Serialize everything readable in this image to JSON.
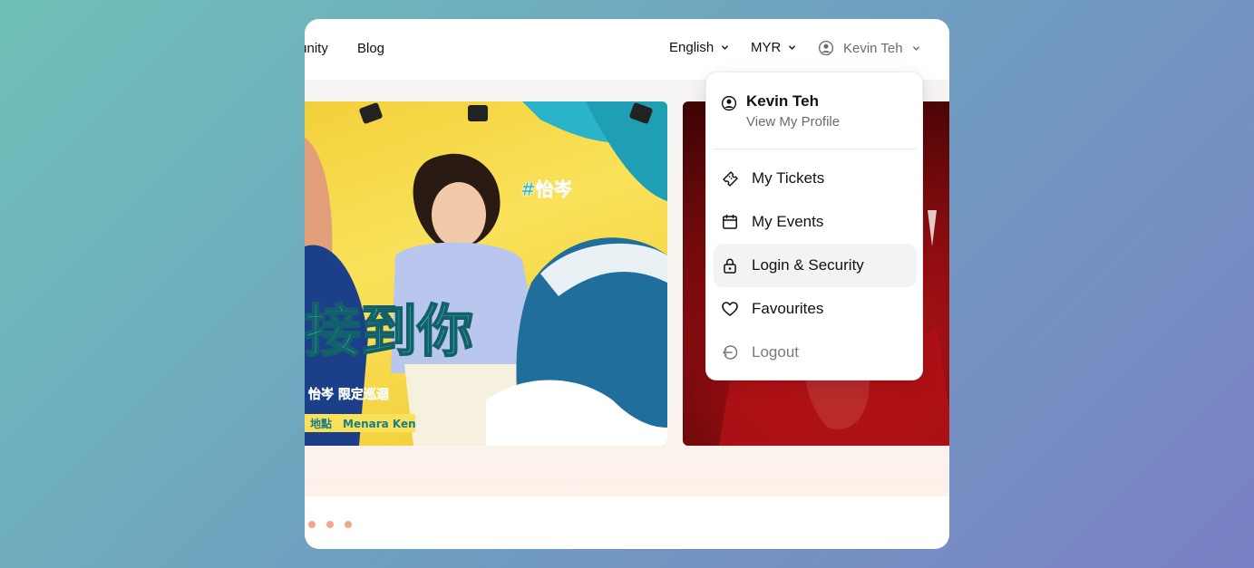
{
  "nav": {
    "community_label": "Community",
    "blog_label": "Blog",
    "language": "English",
    "currency": "MYR",
    "user_name": "Kevin Teh"
  },
  "banner1": {
    "hashtag": "#怡岑",
    "title": "接到你",
    "subtitle": "怡岑 限定巡迴",
    "venue_label": "地點",
    "venue": "Menara Ken"
  },
  "carousel": {
    "dots": 3
  },
  "user_menu": {
    "name": "Kevin Teh",
    "profile_link": "View My Profile",
    "items": [
      {
        "label": "My Tickets",
        "icon": "ticket-icon"
      },
      {
        "label": "My Events",
        "icon": "calendar-icon"
      },
      {
        "label": "Login & Security",
        "icon": "lock-icon"
      },
      {
        "label": "Favourites",
        "icon": "heart-icon"
      },
      {
        "label": "Logout",
        "icon": "logout-icon"
      }
    ]
  },
  "colors": {
    "accent_dot": "#f4a48f",
    "active_bg": "#f2f3f5",
    "background_start": "#6fc1b8",
    "background_end": "#7a80c4"
  }
}
